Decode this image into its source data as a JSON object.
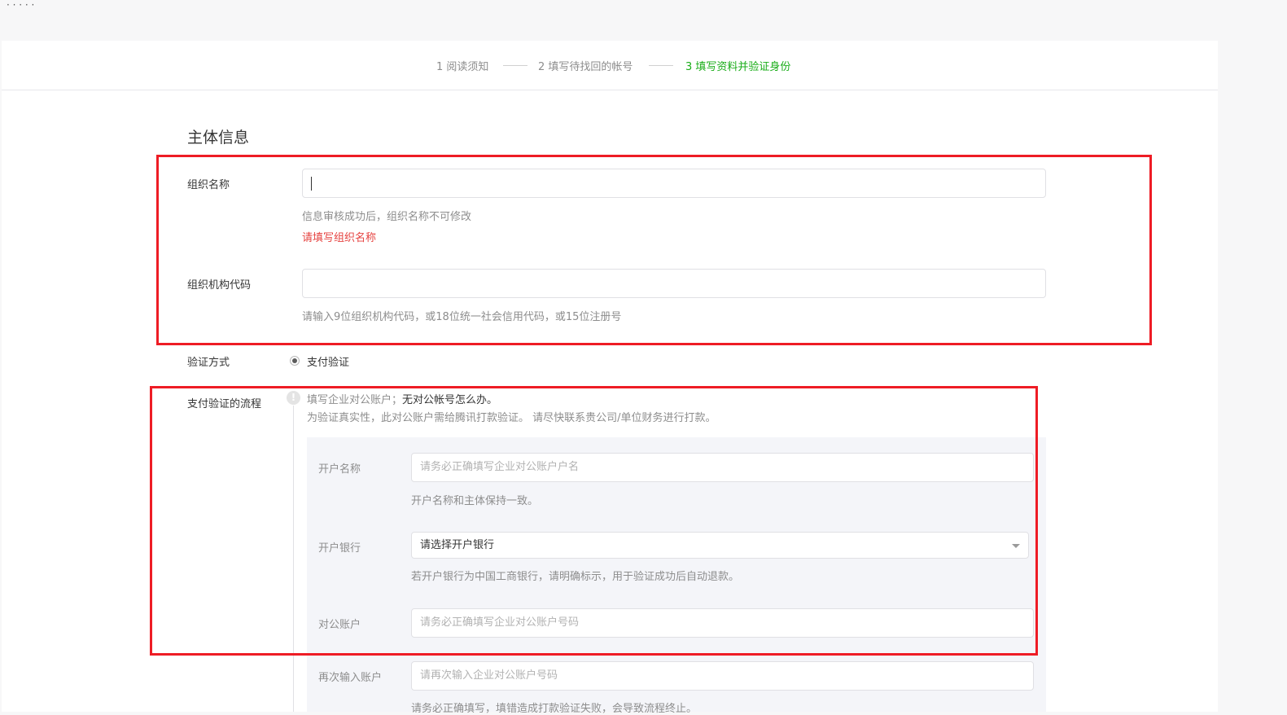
{
  "topbar": {
    "breadcrumb": "· · ·  ·  ·"
  },
  "steps": [
    {
      "label": "1 阅读须知",
      "active": false
    },
    {
      "label": "2 填写待找回的帐号",
      "active": false
    },
    {
      "label": "3 填写资料并验证身份",
      "active": true
    }
  ],
  "section_title": "主体信息",
  "org_name": {
    "label": "组织名称",
    "value": "",
    "tip": "信息审核成功后，组织名称不可修改",
    "error": "请填写组织名称"
  },
  "org_code": {
    "label": "组织机构代码",
    "value": "",
    "tip": "请输入9位组织机构代码，或18位统一社会信用代码，或15位注册号"
  },
  "verify_method": {
    "label": "验证方式",
    "option": "支付验证",
    "selected": true
  },
  "payment_flow": {
    "label": "支付验证的流程",
    "info_line1_prefix": "填写企业对公账户；",
    "info_line1_link": "无对公帐号怎么办。",
    "info_line2": "为验证真实性，此对公账户需给腾讯打款验证。 请尽快联系贵公司/单位财务进行打款。",
    "account_name": {
      "label": "开户名称",
      "placeholder": "请务必正确填写企业对公账户户名",
      "tip": "开户名称和主体保持一致。"
    },
    "bank": {
      "label": "开户银行",
      "selected": "请选择开户银行",
      "tip": "若开户银行为中国工商银行，请明确标示，用于验证成功后自动退款。"
    },
    "account_no": {
      "label": "对公账户",
      "placeholder": "请务必正确填写企业对公账户号码"
    },
    "account_no_repeat": {
      "label": "再次输入账户",
      "placeholder": "请再次输入企业对公账户号码",
      "tip": "请务必正确填写，填错造成打款验证失败，会导致流程终止。"
    }
  },
  "colors": {
    "active_step": "#1aad19",
    "error": "#e64340",
    "highlight_box": "#ee1c25"
  }
}
